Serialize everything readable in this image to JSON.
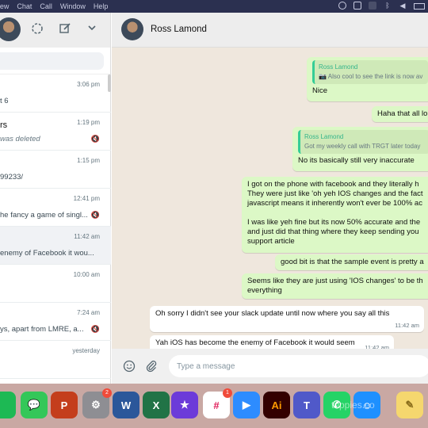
{
  "menubar": {
    "items": [
      "View",
      "Chat",
      "Call",
      "Window",
      "Help"
    ]
  },
  "sidebar": {
    "chats": [
      {
        "name": "",
        "time": "3:06 pm",
        "preview": "t 6",
        "muted": false,
        "italic": false
      },
      {
        "name": "rs",
        "time": "1:19 pm",
        "preview": "was deleted",
        "muted": true,
        "italic": true
      },
      {
        "name": "",
        "time": "1:15 pm",
        "preview": "99233/",
        "muted": false,
        "italic": false
      },
      {
        "name": "",
        "time": "12:41 pm",
        "preview": "he fancy a game of singl...",
        "muted": true,
        "italic": false
      },
      {
        "name": "",
        "time": "11:42 am",
        "preview": "enemy of Facebook it wou...",
        "muted": false,
        "italic": false
      },
      {
        "name": "",
        "time": "10:00 am",
        "preview": "",
        "muted": false,
        "italic": false
      },
      {
        "name": "",
        "time": "7:24 am",
        "preview": "ys, apart from LMRE, a...",
        "muted": true,
        "italic": false
      },
      {
        "name": "",
        "time": "yesterday",
        "preview": "",
        "muted": false,
        "italic": false
      }
    ]
  },
  "conversation": {
    "contact_name": "Ross Lamond",
    "messages": [
      {
        "dir": "out",
        "quote_name": "Ross Lamond",
        "quote_text": "📷 Also cool to see the link is now av",
        "text": "Nice",
        "time": ""
      },
      {
        "dir": "out",
        "quote_name": "",
        "quote_text": "",
        "text": "Haha that all lo",
        "time": ""
      },
      {
        "dir": "out",
        "quote_name": "Ross Lamond",
        "quote_text": "Got my weekly call with TRGT later today",
        "text": "No its basically still very inaccurate",
        "time": ""
      },
      {
        "dir": "out",
        "lines": [
          "I got on the phone with facebook and they literally h",
          "They were just like 'oh yeh IOS changes and the fact",
          "javascript means it inherently won't ever be 100% ac",
          "",
          "I was like yeh fine but its now 50% accurate and the",
          "and just did that thing where they keep sending you",
          "support article"
        ],
        "time": ""
      },
      {
        "dir": "out",
        "text": "good bit is that the sample event is pretty a",
        "time": ""
      },
      {
        "dir": "out",
        "lines": [
          "Seems like they are just using 'IOS changes' to be th",
          "everything"
        ],
        "time": ""
      },
      {
        "dir": "in",
        "text": "Oh sorry I didn't see your slack update until now where you say all this",
        "time": "11:42 am"
      },
      {
        "dir": "in",
        "text": "Yah iOS has become the enemy of Facebook it would seem",
        "time": "11:42 am"
      }
    ]
  },
  "composer": {
    "placeholder": "Type a message"
  },
  "dock": {
    "apps": [
      {
        "name": "spotify",
        "label": "",
        "color": "#1db954",
        "badge": ""
      },
      {
        "name": "messages",
        "label": "💬",
        "color": "#34c759",
        "badge": ""
      },
      {
        "name": "powerpoint",
        "label": "P",
        "color": "#c43e1c",
        "badge": ""
      },
      {
        "name": "system-preferences",
        "label": "⚙",
        "color": "#8e8e93",
        "badge": "2"
      },
      {
        "name": "word",
        "label": "W",
        "color": "#2b579a",
        "badge": ""
      },
      {
        "name": "excel",
        "label": "X",
        "color": "#217346",
        "badge": ""
      },
      {
        "name": "imovie",
        "label": "★",
        "color": "#6c3bd9",
        "badge": ""
      },
      {
        "name": "slack",
        "label": "#",
        "color": "#ffffff",
        "badge": "1"
      },
      {
        "name": "zoom",
        "label": "▶",
        "color": "#2d8cff",
        "badge": ""
      },
      {
        "name": "illustrator",
        "label": "Ai",
        "color": "#330000",
        "badge": ""
      },
      {
        "name": "teams",
        "label": "T",
        "color": "#5059c9",
        "badge": ""
      },
      {
        "name": "whatsapp",
        "label": "✆",
        "color": "#25d366",
        "badge": ""
      },
      {
        "name": "finder",
        "label": "☺",
        "color": "#1e90ff",
        "badge": ""
      },
      {
        "name": "notes",
        "label": "✎",
        "color": "#f5d76e",
        "badge": ""
      }
    ]
  },
  "watermark": "tuppies.co"
}
